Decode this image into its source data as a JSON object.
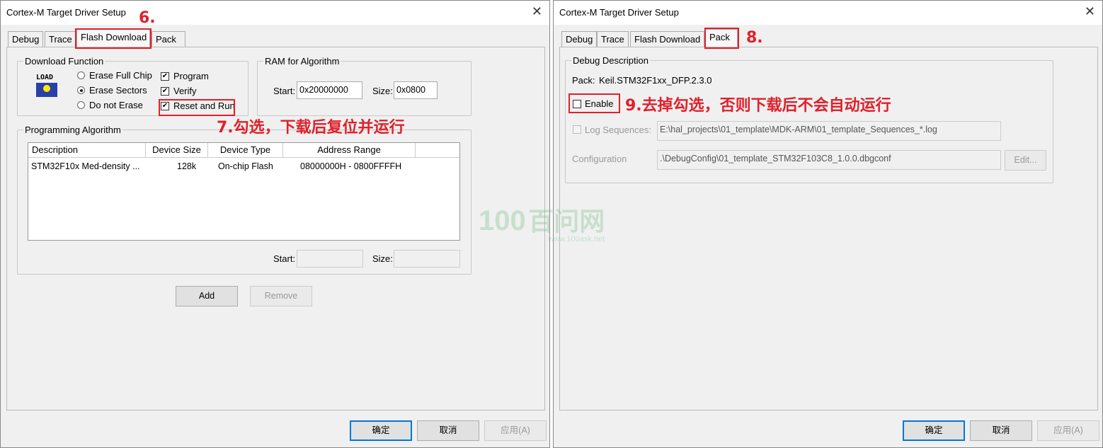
{
  "left": {
    "title": "Cortex-M Target Driver Setup",
    "tabs": [
      "Debug",
      "Trace",
      "Flash Download",
      "Pack"
    ],
    "active_tab": "Flash Download",
    "download_function": {
      "legend": "Download Function",
      "icon_text": "LOAD",
      "radios": [
        {
          "label": "Erase Full Chip",
          "selected": false
        },
        {
          "label": "Erase Sectors",
          "selected": true
        },
        {
          "label": "Do not Erase",
          "selected": false
        }
      ],
      "checks": [
        {
          "label": "Program",
          "checked": true
        },
        {
          "label": "Verify",
          "checked": true
        },
        {
          "label": "Reset and Run",
          "checked": true
        }
      ]
    },
    "ram": {
      "legend": "RAM for Algorithm",
      "start_label": "Start:",
      "start": "0x20000000",
      "size_label": "Size:",
      "size": "0x0800"
    },
    "algorithm": {
      "legend": "Programming Algorithm",
      "columns": [
        "Description",
        "Device Size",
        "Device Type",
        "Address Range"
      ],
      "rows": [
        [
          "STM32F10x Med-density ...",
          "128k",
          "On-chip Flash",
          "08000000H - 0800FFFFH"
        ]
      ],
      "start_label": "Start:",
      "start": "",
      "size_label": "Size:",
      "size": ""
    },
    "add": "Add",
    "remove": "Remove",
    "ok": "确定",
    "cancel": "取消",
    "apply": "应用(A)"
  },
  "right": {
    "title": "Cortex-M Target Driver Setup",
    "tabs": [
      "Debug",
      "Trace",
      "Flash Download",
      "Pack"
    ],
    "active_tab": "Pack",
    "debug_description": {
      "legend": "Debug Description",
      "pack_label": "Pack:",
      "pack": "Keil.STM32F1xx_DFP.2.3.0",
      "enable": {
        "label": "Enable",
        "checked": false
      },
      "log_sequences": {
        "label": "Log Sequences:",
        "checked": false,
        "value": "E:\\hal_projects\\01_template\\MDK-ARM\\01_template_Sequences_*.log"
      },
      "configuration": {
        "label": "Configuration",
        "value": ".\\DebugConfig\\01_template_STM32F103C8_1.0.0.dbgconf",
        "edit": "Edit..."
      }
    },
    "ok": "确定",
    "cancel": "取消",
    "apply": "应用(A)"
  },
  "annotations": {
    "a6": "6.",
    "a7": "7.勾选，下载后复位并运行",
    "a8": "8.",
    "a9": "9.去掉勾选，否则下载后不会自动运行",
    "color": "#e0202a"
  },
  "watermark": {
    "logo": "100",
    "name": "百问网",
    "url": "www.100ask.net"
  }
}
